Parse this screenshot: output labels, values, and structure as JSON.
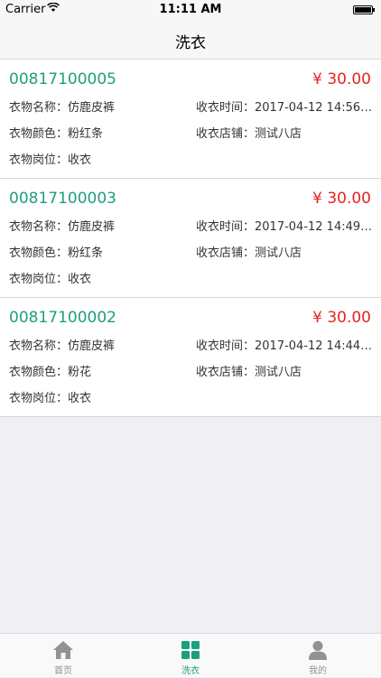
{
  "status_bar": {
    "carrier": "Carrier",
    "time": "11:11 AM"
  },
  "nav": {
    "title": "洗衣"
  },
  "orders": [
    {
      "order_no": "00817100005",
      "price": "¥ 30.00",
      "name": "衣物名称：仿鹿皮裤",
      "color": "衣物颜色：粉红条",
      "position": "衣物岗位：收衣",
      "time": "收衣时间：2017-04-12 14:56:...",
      "store": "收衣店铺：测试八店"
    },
    {
      "order_no": "00817100003",
      "price": "¥ 30.00",
      "name": "衣物名称：仿鹿皮裤",
      "color": "衣物颜色：粉红条",
      "position": "衣物岗位：收衣",
      "time": "收衣时间：2017-04-12 14:49:...",
      "store": "收衣店铺：测试八店"
    },
    {
      "order_no": "00817100002",
      "price": "¥ 30.00",
      "name": "衣物名称：仿鹿皮裤",
      "color": "衣物颜色：粉花",
      "position": "衣物岗位：收衣",
      "time": "收衣时间：2017-04-12 14:44:...",
      "store": "收衣店铺：测试八店"
    }
  ],
  "tabs": [
    {
      "label": "首页",
      "icon": "home-icon"
    },
    {
      "label": "洗衣",
      "icon": "grid-icon"
    },
    {
      "label": "我的",
      "icon": "person-icon"
    }
  ],
  "colors": {
    "accent": "#1f9e7e",
    "price": "#e32424",
    "inactive": "#929292"
  }
}
